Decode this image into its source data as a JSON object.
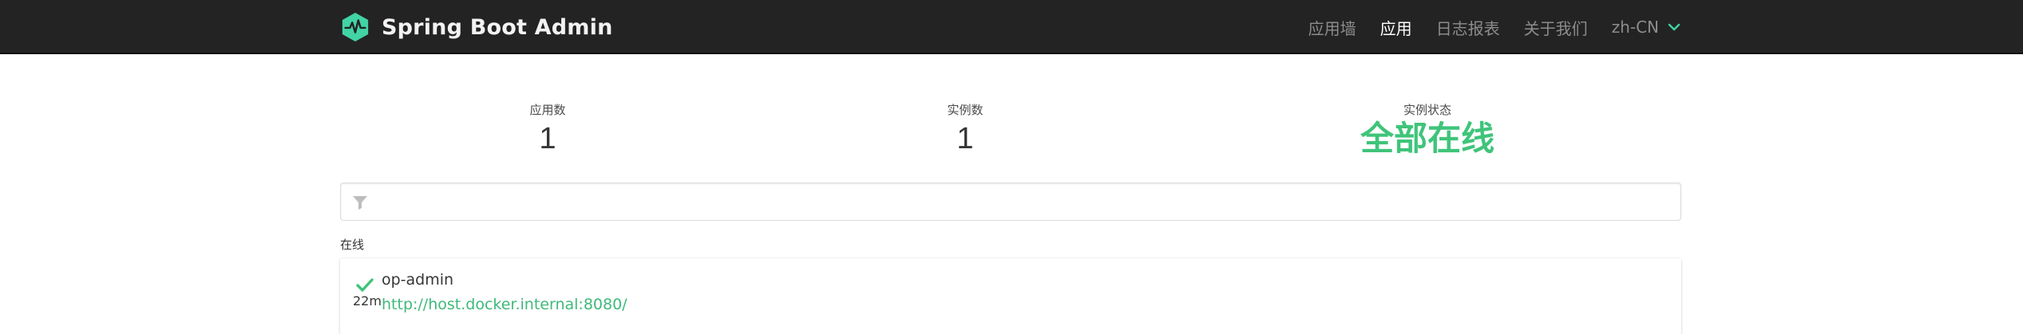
{
  "navbar": {
    "brand_title": "Spring Boot Admin",
    "items": [
      {
        "label": "应用墙",
        "active": false
      },
      {
        "label": "应用",
        "active": true
      },
      {
        "label": "日志报表",
        "active": false
      },
      {
        "label": "关于我们",
        "active": false
      }
    ],
    "language": {
      "label": "zh-CN",
      "icon": "chevron-down-icon"
    },
    "logo_icon": "heartbeat-hexagon-icon",
    "colors": {
      "background": "#232323",
      "accent": "#42d3a5"
    }
  },
  "stats": {
    "applications": {
      "label": "应用数",
      "value": "1"
    },
    "instances": {
      "label": "实例数",
      "value": "1"
    },
    "status": {
      "label": "实例状态",
      "value": "全部在线",
      "color": "#3fc47a"
    }
  },
  "filter": {
    "icon": "filter-icon",
    "value": "",
    "placeholder": ""
  },
  "groups": [
    {
      "label": "在线",
      "applications": [
        {
          "status_icon": "check-icon",
          "uptime": "22m",
          "name": "op-admin",
          "url": "http://host.docker.internal:8080/"
        }
      ]
    }
  ]
}
